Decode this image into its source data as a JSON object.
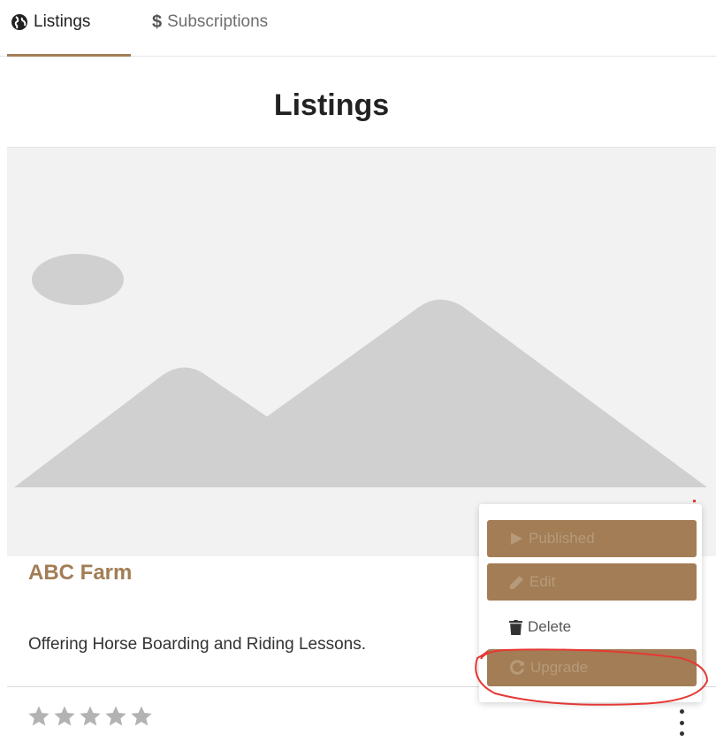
{
  "tabs": [
    {
      "label": "Listings",
      "icon": "globe-icon",
      "active": true
    },
    {
      "label": "Subscriptions",
      "icon": "dollar-icon",
      "active": false
    }
  ],
  "page": {
    "title": "Listings"
  },
  "listing": {
    "image": "image-placeholder-icon",
    "title": "ABC Farm",
    "description": "Offering Horse Boarding and Riding Lessons.",
    "rating": {
      "value": 0,
      "max": 5
    }
  },
  "menu": {
    "items": [
      {
        "label": "Published",
        "icon": "play-icon"
      },
      {
        "label": "Edit",
        "icon": "pencil-icon"
      },
      {
        "label": "Delete",
        "icon": "trash-icon"
      },
      {
        "label": "Upgrade",
        "icon": "refresh-icon"
      }
    ]
  },
  "colors": {
    "accent": "#a27d55",
    "placeholder_bg": "#f2f2f2",
    "placeholder_shape": "#d0d0d0",
    "star": "#b3b3b3",
    "annotation": "#e53935"
  }
}
